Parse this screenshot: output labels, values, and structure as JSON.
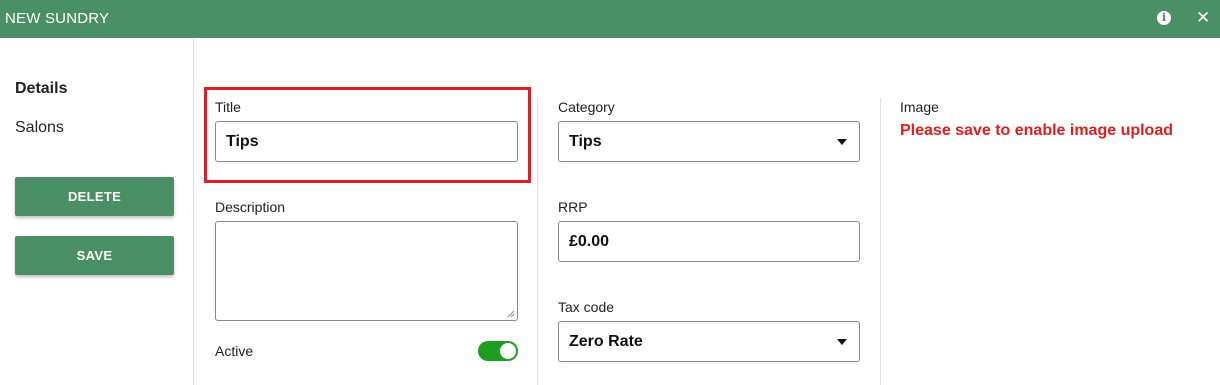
{
  "header": {
    "title": "NEW SUNDRY",
    "icons": [
      "info-icon",
      "close-icon"
    ],
    "background": "#4b8f65"
  },
  "sidebar": {
    "items": [
      {
        "label": "Details",
        "active": true
      },
      {
        "label": "Salons",
        "active": false
      }
    ],
    "delete_label": "DELETE",
    "save_label": "SAVE"
  },
  "form": {
    "title_label": "Title",
    "title_value": "Tips",
    "description_label": "Description",
    "description_value": "",
    "active_label": "Active",
    "active_on": true,
    "category_label": "Category",
    "category_value": "Tips",
    "rrp_label": "RRP",
    "rrp_value": "£0.00",
    "tax_label": "Tax code",
    "tax_value": "Zero Rate",
    "image_label": "Image",
    "image_message": "Please save to enable image upload"
  },
  "colors": {
    "accent": "#4b8f65",
    "highlight": "#dc1f26",
    "toggle_on": "#1e9e1e",
    "error": "#e51c1c"
  }
}
